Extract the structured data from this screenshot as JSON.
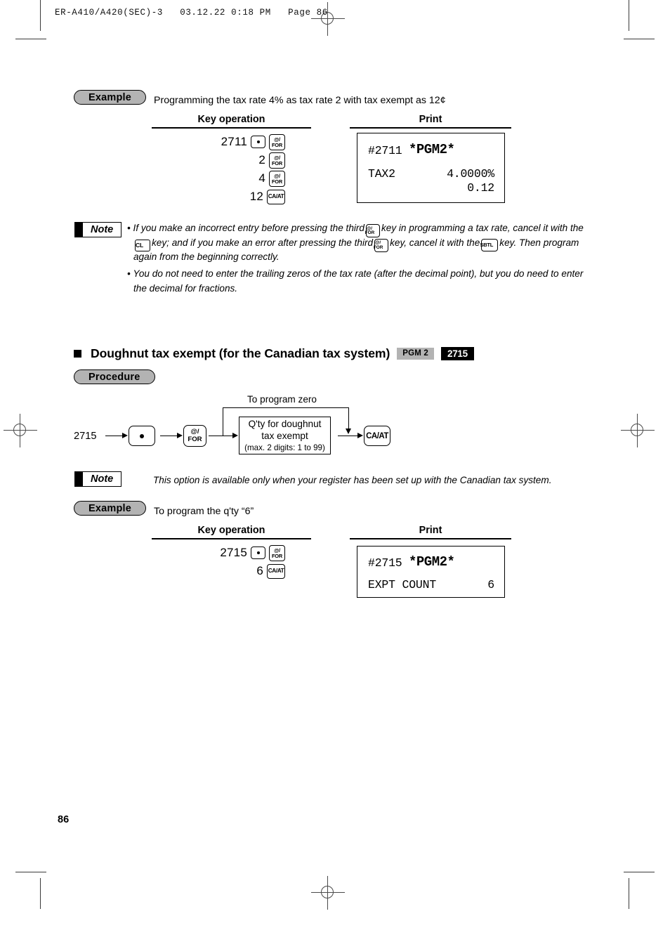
{
  "page": {
    "header_line": "ER-A410/A420(SEC)-3   03.12.22 0:18 PM   Page 86",
    "number": "86"
  },
  "example1": {
    "badge": "Example",
    "caption": "Programming the tax rate 4% as tax rate 2 with tax exempt as 12¢",
    "col_key": "Key operation",
    "col_print": "Print",
    "rows": [
      {
        "num": "2711",
        "keys": [
          "dot",
          "for"
        ]
      },
      {
        "num": "2",
        "keys": [
          "for"
        ]
      },
      {
        "num": "4",
        "keys": [
          "for"
        ]
      },
      {
        "num": "12",
        "keys": [
          "caat"
        ]
      }
    ],
    "receipt": {
      "line1_left": "#2711",
      "line1_right": "*PGM2*",
      "line2_left": "TAX2",
      "line2_right": "4.0000%",
      "line3_right": "0.12"
    }
  },
  "note1": {
    "badge": "Note",
    "b1_p1": "If you make an incorrect entry before pressing the third",
    "b1_p2": "key in programming a tax rate, cancel it with the",
    "b1_p3": "key; and if you make an error after pressing the third",
    "b1_p4": "key, cancel it with the",
    "b1_p5": "key.  Then program again from the beginning correctly.",
    "b2": "You do not need to enter the trailing zeros of the tax rate (after the decimal point), but you do need to enter the decimal for fractions."
  },
  "section": {
    "title": "Doughnut tax exempt (for the Canadian tax system)",
    "badge_pgm": "PGM 2",
    "badge_code": "2715",
    "procedure_badge": "Procedure"
  },
  "flow": {
    "start_num": "2715",
    "zero_label": "To program zero",
    "key_dot": ".",
    "key_for_l1": "@/",
    "key_for_l2": "FOR",
    "box_l1": "Q'ty for doughnut",
    "box_l2": "tax exempt",
    "box_l3": "(max. 2 digits: 1 to 99)",
    "key_caat": "CA/AT"
  },
  "note2": {
    "badge": "Note",
    "text": "This option is available only when your register has been set up with the Canadian tax system."
  },
  "example2": {
    "badge": "Example",
    "caption": "To program the q'ty “6”",
    "col_key": "Key operation",
    "col_print": "Print",
    "rows": [
      {
        "num": "2715",
        "keys": [
          "dot",
          "for"
        ]
      },
      {
        "num": "6",
        "keys": [
          "caat"
        ]
      }
    ],
    "receipt": {
      "line1_left": "#2715",
      "line1_right": "*PGM2*",
      "line2_left": "EXPT COUNT",
      "line2_right": "6"
    }
  },
  "keys": {
    "for_l1": "@/",
    "for_l2": "FOR",
    "caat": "CA/AT",
    "cl": "CL",
    "sbtl": "SBTL"
  }
}
